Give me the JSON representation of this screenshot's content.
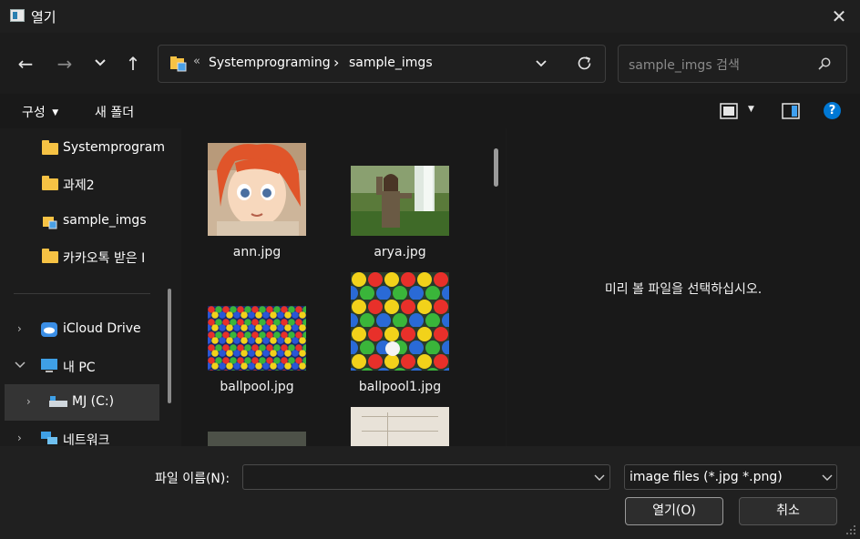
{
  "window": {
    "title": "열기",
    "close_glyph": "✕"
  },
  "nav": {
    "back_glyph": "←",
    "forward_glyph": "→",
    "recent_glyph": "⌄",
    "up_glyph": "↑"
  },
  "address": {
    "overflow_glyph": "«",
    "segments": [
      "Systemprograming",
      "sample_imgs"
    ],
    "separator": "›"
  },
  "search": {
    "placeholder": "sample_imgs 검색"
  },
  "toolbar": {
    "organize_label": "구성",
    "new_folder_label": "새 폴더",
    "help_glyph": "?"
  },
  "sidebar": {
    "items": [
      {
        "label": "Systemprogram"
      },
      {
        "label": "과제2"
      },
      {
        "label": "sample_imgs"
      },
      {
        "label": "카카오톡 받은 I"
      },
      {
        "label": "iCloud Drive"
      },
      {
        "label": "내 PC"
      },
      {
        "label": "MJ (C:)"
      },
      {
        "label": "네트워크"
      }
    ]
  },
  "files": [
    {
      "name": "ann.jpg"
    },
    {
      "name": "arya.jpg"
    },
    {
      "name": "ballpool.jpg"
    },
    {
      "name": "ballpool1.jpg"
    }
  ],
  "preview": {
    "message": "미리 볼 파일을 선택하십시오."
  },
  "footer": {
    "filename_label": "파일 이름(N):",
    "filename_value": "",
    "filter_value": "image files (*.jpg *.png)",
    "open_label": "열기(O)",
    "cancel_label": "취소"
  },
  "colors": {
    "accent": "#0078d4",
    "folder": "#f6c244",
    "background": "#1c1c1c"
  }
}
